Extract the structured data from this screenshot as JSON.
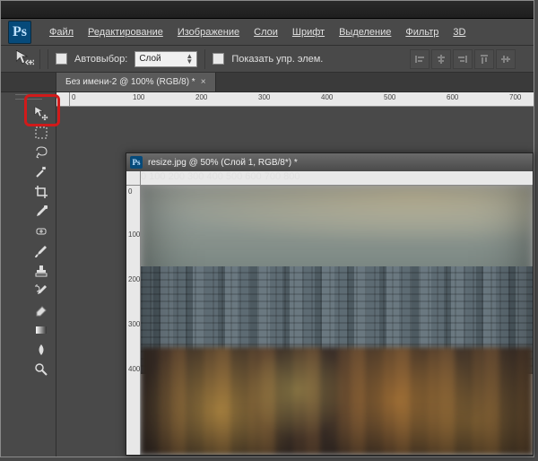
{
  "logo": "Ps",
  "menu": {
    "file": "Файл",
    "edit": "Редактирование",
    "image": "Изображение",
    "layers": "Слои",
    "type": "Шрифт",
    "select": "Выделение",
    "filter": "Фильтр",
    "threeD": "3D"
  },
  "options": {
    "autoselect_label": "Автовыбор:",
    "dropdown_value": "Слой",
    "show_controls_label": "Показать упр. элем."
  },
  "docTab": {
    "title": "Без имени-2 @ 100% (RGB/8) *",
    "close": "×"
  },
  "rulerTop": [
    "0",
    "100",
    "200",
    "300",
    "400",
    "500",
    "600",
    "700"
  ],
  "innerDoc": {
    "title": "resize.jpg @ 50% (Слой 1, RGB/8*) *",
    "rulerH": [
      "0",
      "100",
      "200",
      "300",
      "400",
      "500",
      "600",
      "700",
      "800"
    ],
    "rulerV": [
      "0",
      "100",
      "200",
      "300",
      "400"
    ]
  },
  "tools": {
    "move": "move-tool",
    "marquee": "marquee-tool",
    "lasso": "lasso-tool",
    "wand": "wand-tool",
    "crop": "crop-tool",
    "eyedropper": "eyedropper-tool",
    "heal": "heal-tool",
    "brush": "brush-tool",
    "stamp": "stamp-tool",
    "history": "history-brush-tool",
    "eraser": "eraser-tool",
    "gradient": "gradient-tool",
    "blur": "blur-tool",
    "dodge": "dodge-tool"
  }
}
